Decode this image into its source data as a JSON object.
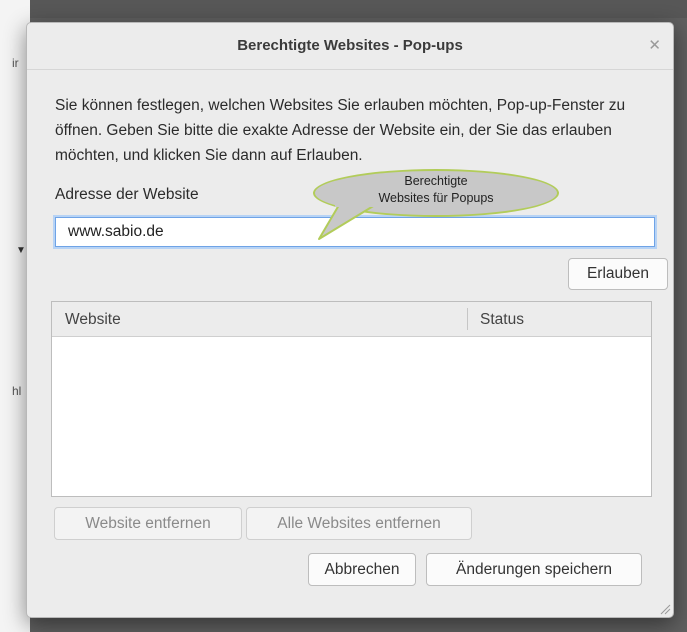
{
  "background": {
    "text_1": "ir",
    "text_2": "hl"
  },
  "dialog": {
    "title": "Berechtigte Websites - Pop-ups",
    "description": "Sie können festlegen, welchen Websites Sie erlauben möchten, Pop-up-Fenster zu öffnen. Geben Sie bitte die exakte Adresse der Website ein, der Sie das erlauben möchten, und klicken Sie dann auf Erlauben.",
    "address_label": "Adresse der Website",
    "address_value": "www.sabio.de",
    "allow_button": "Erlauben",
    "table": {
      "columns": [
        "Website",
        "Status"
      ],
      "rows": []
    },
    "remove_button": "Website entfernen",
    "remove_all_button": "Alle Websites entfernen",
    "cancel_button": "Abbrechen",
    "save_button": "Änderungen speichern"
  },
  "annotation": {
    "line1": "Berechtigte",
    "line2": "Websites für Popups"
  },
  "colors": {
    "dialog_bg": "#ececec",
    "focus_ring": "#6fa3e6",
    "bubble_fill": "#c8c8c8",
    "bubble_border": "#b2cc5a"
  }
}
